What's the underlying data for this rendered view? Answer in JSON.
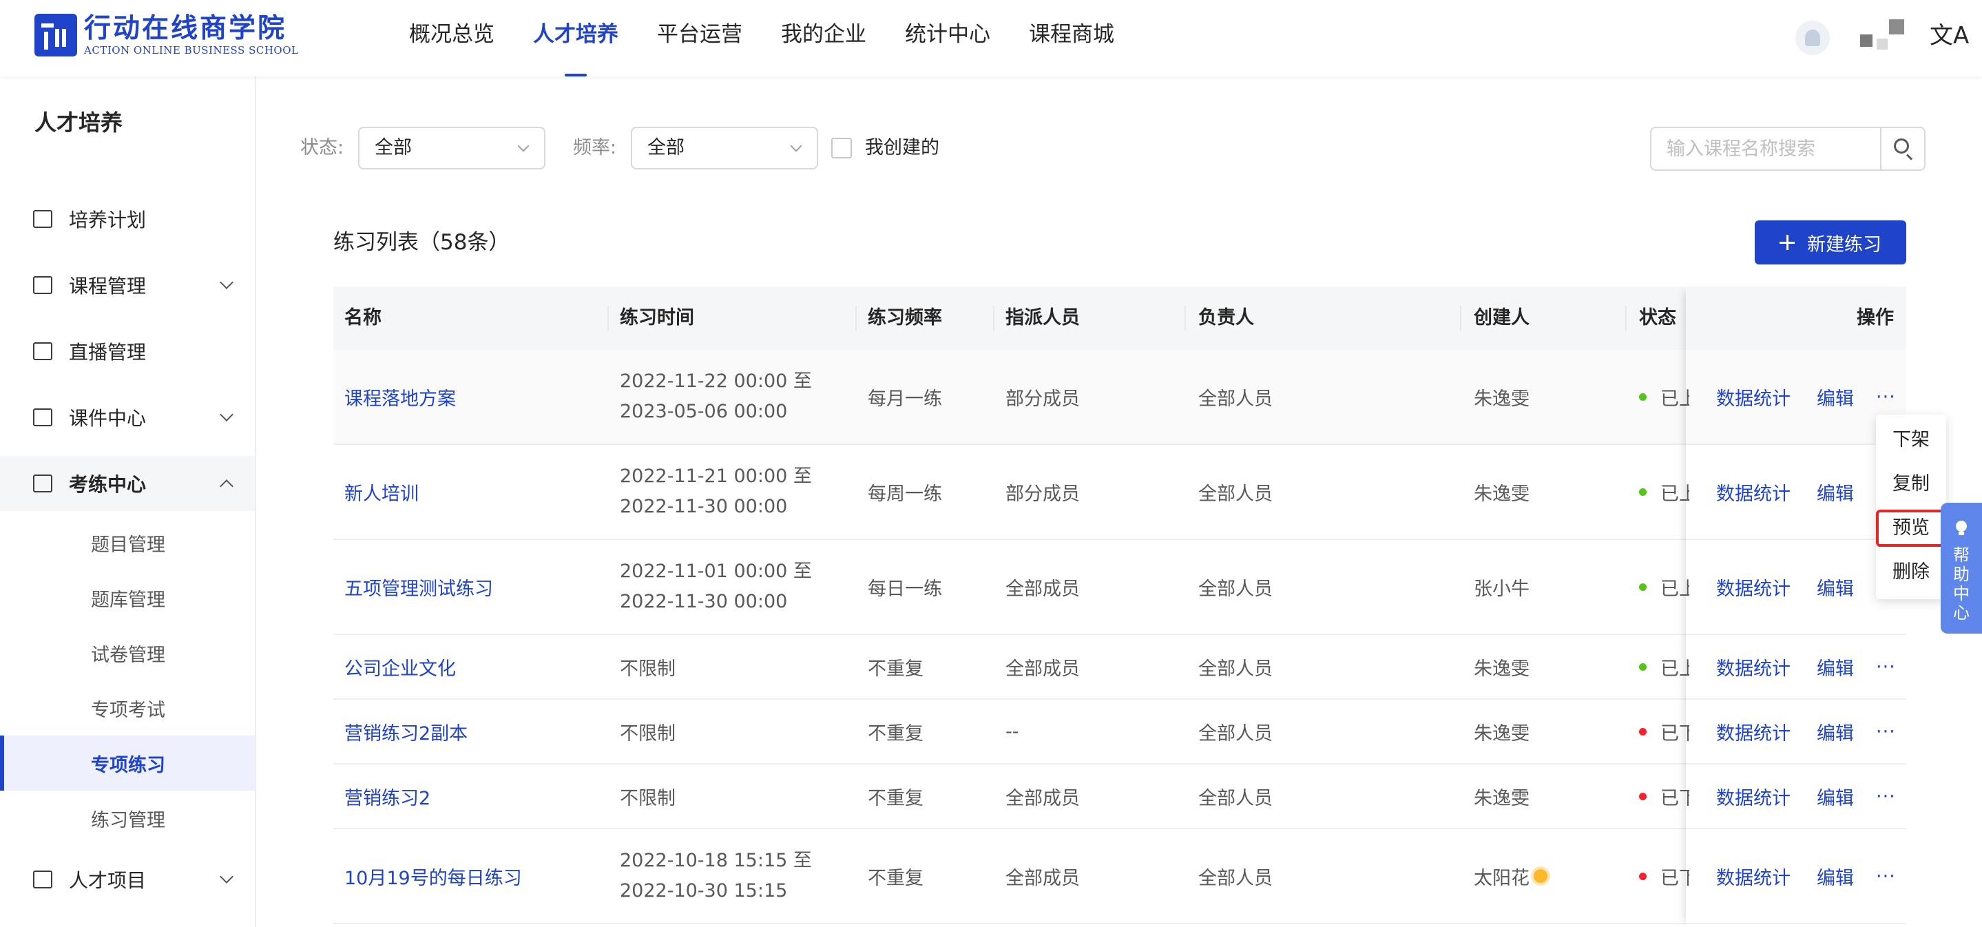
{
  "header": {
    "logo_cn": "行动在线商学院",
    "logo_en": "ACTION ONLINE BUSINESS SCHOOL",
    "nav": [
      {
        "label": "概况总览",
        "active": false
      },
      {
        "label": "人才培养",
        "active": true
      },
      {
        "label": "平台运营",
        "active": false
      },
      {
        "label": "我的企业",
        "active": false
      },
      {
        "label": "统计中心",
        "active": false
      },
      {
        "label": "课程商城",
        "active": false
      }
    ],
    "lang_icon": "文A"
  },
  "sidebar": {
    "title": "人才培养",
    "items": [
      {
        "label": "培养计划",
        "icon": "calendar-icon"
      },
      {
        "label": "课程管理",
        "icon": "book-icon"
      },
      {
        "label": "直播管理",
        "icon": "video-icon"
      },
      {
        "label": "课件中心",
        "icon": "inbox-icon"
      },
      {
        "label": "考练中心",
        "icon": "exam-icon"
      },
      {
        "label": "人才项目",
        "icon": "project-icon"
      }
    ],
    "sub_items": [
      {
        "label": "题目管理"
      },
      {
        "label": "题库管理"
      },
      {
        "label": "试卷管理"
      },
      {
        "label": "专项考试"
      },
      {
        "label": "专项练习",
        "active": true
      },
      {
        "label": "练习管理"
      }
    ]
  },
  "filters": {
    "status_label": "状态:",
    "status_value": "全部",
    "freq_label": "频率:",
    "freq_value": "全部",
    "mine_label": "我创建的",
    "search_placeholder": "输入课程名称搜索"
  },
  "list": {
    "title": "练习列表（58条）",
    "new_button": "新建练习"
  },
  "table": {
    "headers": [
      "名称",
      "练习时间",
      "练习频率",
      "指派人员",
      "负责人",
      "创建人",
      "状态",
      "操作"
    ],
    "rows": [
      {
        "name": "课程落地方案",
        "time1": "2022-11-22 00:00 至",
        "time2": "2023-05-06 00:00",
        "freq": "每月一练",
        "assign": "部分成员",
        "owner": "全部人员",
        "creator": "朱逸雯",
        "status": "已上架",
        "status_color": "#52c41a"
      },
      {
        "name": "新人培训",
        "time1": "2022-11-21 00:00 至",
        "time2": "2022-11-30 00:00",
        "freq": "每周一练",
        "assign": "部分成员",
        "owner": "全部人员",
        "creator": "朱逸雯",
        "status": "已上架",
        "status_color": "#52c41a"
      },
      {
        "name": "五项管理测试练习",
        "time1": "2022-11-01 00:00 至",
        "time2": "2022-11-30 00:00",
        "freq": "每日一练",
        "assign": "全部成员",
        "owner": "全部人员",
        "creator": "张小牛",
        "status": "已上架",
        "status_color": "#52c41a"
      },
      {
        "name": "公司企业文化",
        "time1": "不限制",
        "time2": "",
        "freq": "不重复",
        "assign": "全部成员",
        "owner": "全部人员",
        "creator": "朱逸雯",
        "status": "已上架",
        "status_color": "#52c41a"
      },
      {
        "name": "营销练习2副本",
        "time1": "不限制",
        "time2": "",
        "freq": "不重复",
        "assign": "--",
        "owner": "全部人员",
        "creator": "朱逸雯",
        "status": "已下架",
        "status_color": "#f5222d"
      },
      {
        "name": "营销练习2",
        "time1": "不限制",
        "time2": "",
        "freq": "不重复",
        "assign": "全部成员",
        "owner": "全部人员",
        "creator": "朱逸雯",
        "status": "已下架",
        "status_color": "#f5222d"
      },
      {
        "name": "10月19号的每日练习",
        "time1": "2022-10-18 15:15 至",
        "time2": "2022-10-30 15:15",
        "freq": "不重复",
        "assign": "全部成员",
        "owner": "全部人员",
        "creator": "太阳花",
        "status": "已下架",
        "status_color": "#f5222d"
      }
    ],
    "actions": {
      "stats": "数据统计",
      "edit": "编辑",
      "more": "···"
    }
  },
  "dropdown": {
    "items": [
      "下架",
      "复制",
      "预览",
      "删除"
    ],
    "highlighted": "预览"
  },
  "help": {
    "label": "帮助中心"
  },
  "colors": {
    "primary": "#1f43c9",
    "active_dot": "#52c41a",
    "inactive_dot": "#f5222d",
    "highlight": "#e3262a",
    "help_bg": "#5f86ea"
  }
}
